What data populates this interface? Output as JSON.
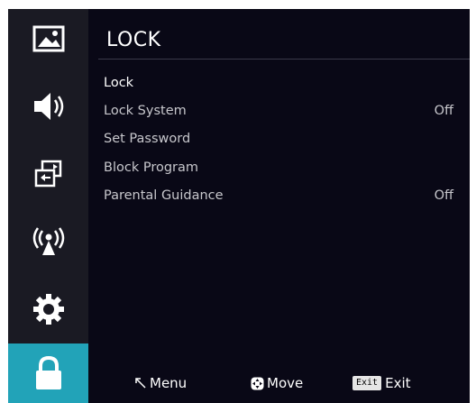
{
  "menu": {
    "title": "LOCK",
    "items": [
      {
        "label": "Lock",
        "value": ""
      },
      {
        "label": "Lock System",
        "value": "Off"
      },
      {
        "label": "Set Password",
        "value": ""
      },
      {
        "label": "Block Program",
        "value": ""
      },
      {
        "label": "Parental Guidance",
        "value": "Off"
      }
    ]
  },
  "sidebar": {
    "items": [
      {
        "icon": "picture-icon"
      },
      {
        "icon": "sound-icon"
      },
      {
        "icon": "input-source-icon"
      },
      {
        "icon": "channel-broadcast-icon"
      },
      {
        "icon": "settings-gear-icon"
      },
      {
        "icon": "lock-icon",
        "active": true
      }
    ]
  },
  "footer": {
    "menu_label": "Menu",
    "move_label": "Move",
    "exit_key": "Exit",
    "exit_label": "Exit"
  },
  "colors": {
    "background": "#090816",
    "sidebar": "#1a1a23",
    "active_tab": "#22a3b8",
    "text": "#ffffff"
  }
}
